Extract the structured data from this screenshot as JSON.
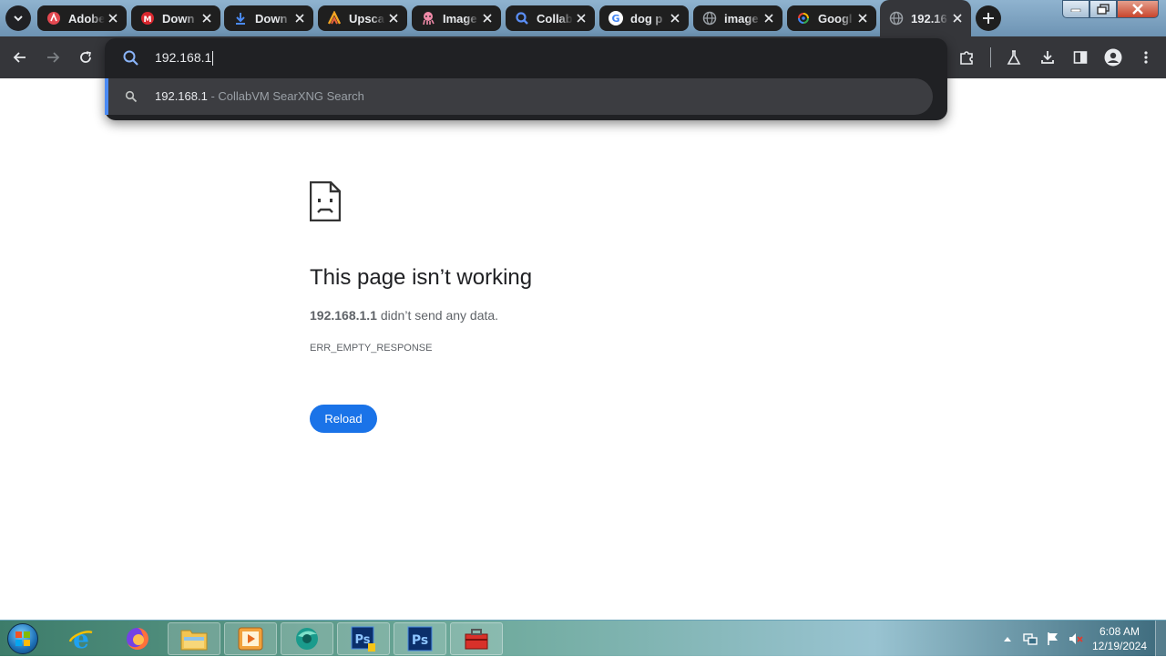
{
  "browser": {
    "tabs": [
      {
        "title": "Adobe",
        "icon": "adobe-icon",
        "active": false
      },
      {
        "title": "Down",
        "icon": "mega-icon",
        "active": false
      },
      {
        "title": "Down",
        "icon": "download-icon",
        "active": false
      },
      {
        "title": "Upsca",
        "icon": "upscale-icon",
        "active": false
      },
      {
        "title": "Image",
        "icon": "octopus-icon",
        "active": false
      },
      {
        "title": "Collab",
        "icon": "search-icon",
        "active": false
      },
      {
        "title": "dog p",
        "icon": "google-icon",
        "active": false
      },
      {
        "title": "image",
        "icon": "globe-icon",
        "active": false
      },
      {
        "title": "Googl",
        "icon": "google-lens-icon",
        "active": false
      },
      {
        "title": "192.16",
        "icon": "globe-icon",
        "active": true
      }
    ],
    "omnibox": {
      "value": "192.168.1",
      "suggestion": {
        "query": "192.168.1",
        "separator": " - ",
        "provider": "CollabVM SearXNG Search"
      }
    }
  },
  "error_page": {
    "title": "This page isn’t working",
    "host": "192.168.1.1",
    "message": " didn’t send any data.",
    "code": "ERR_EMPTY_RESPONSE",
    "reload_label": "Reload"
  },
  "taskbar": {
    "apps": [
      "internet-explorer",
      "firefox",
      "file-explorer",
      "media-player",
      "browser",
      "photoshop-elements",
      "photoshop",
      "toolbox"
    ],
    "clock_time": "6:08 AM",
    "clock_date": "12/19/2024"
  },
  "colors": {
    "accent": "#1a73e8",
    "toolbar": "#35363a",
    "omnibox": "#202124"
  }
}
